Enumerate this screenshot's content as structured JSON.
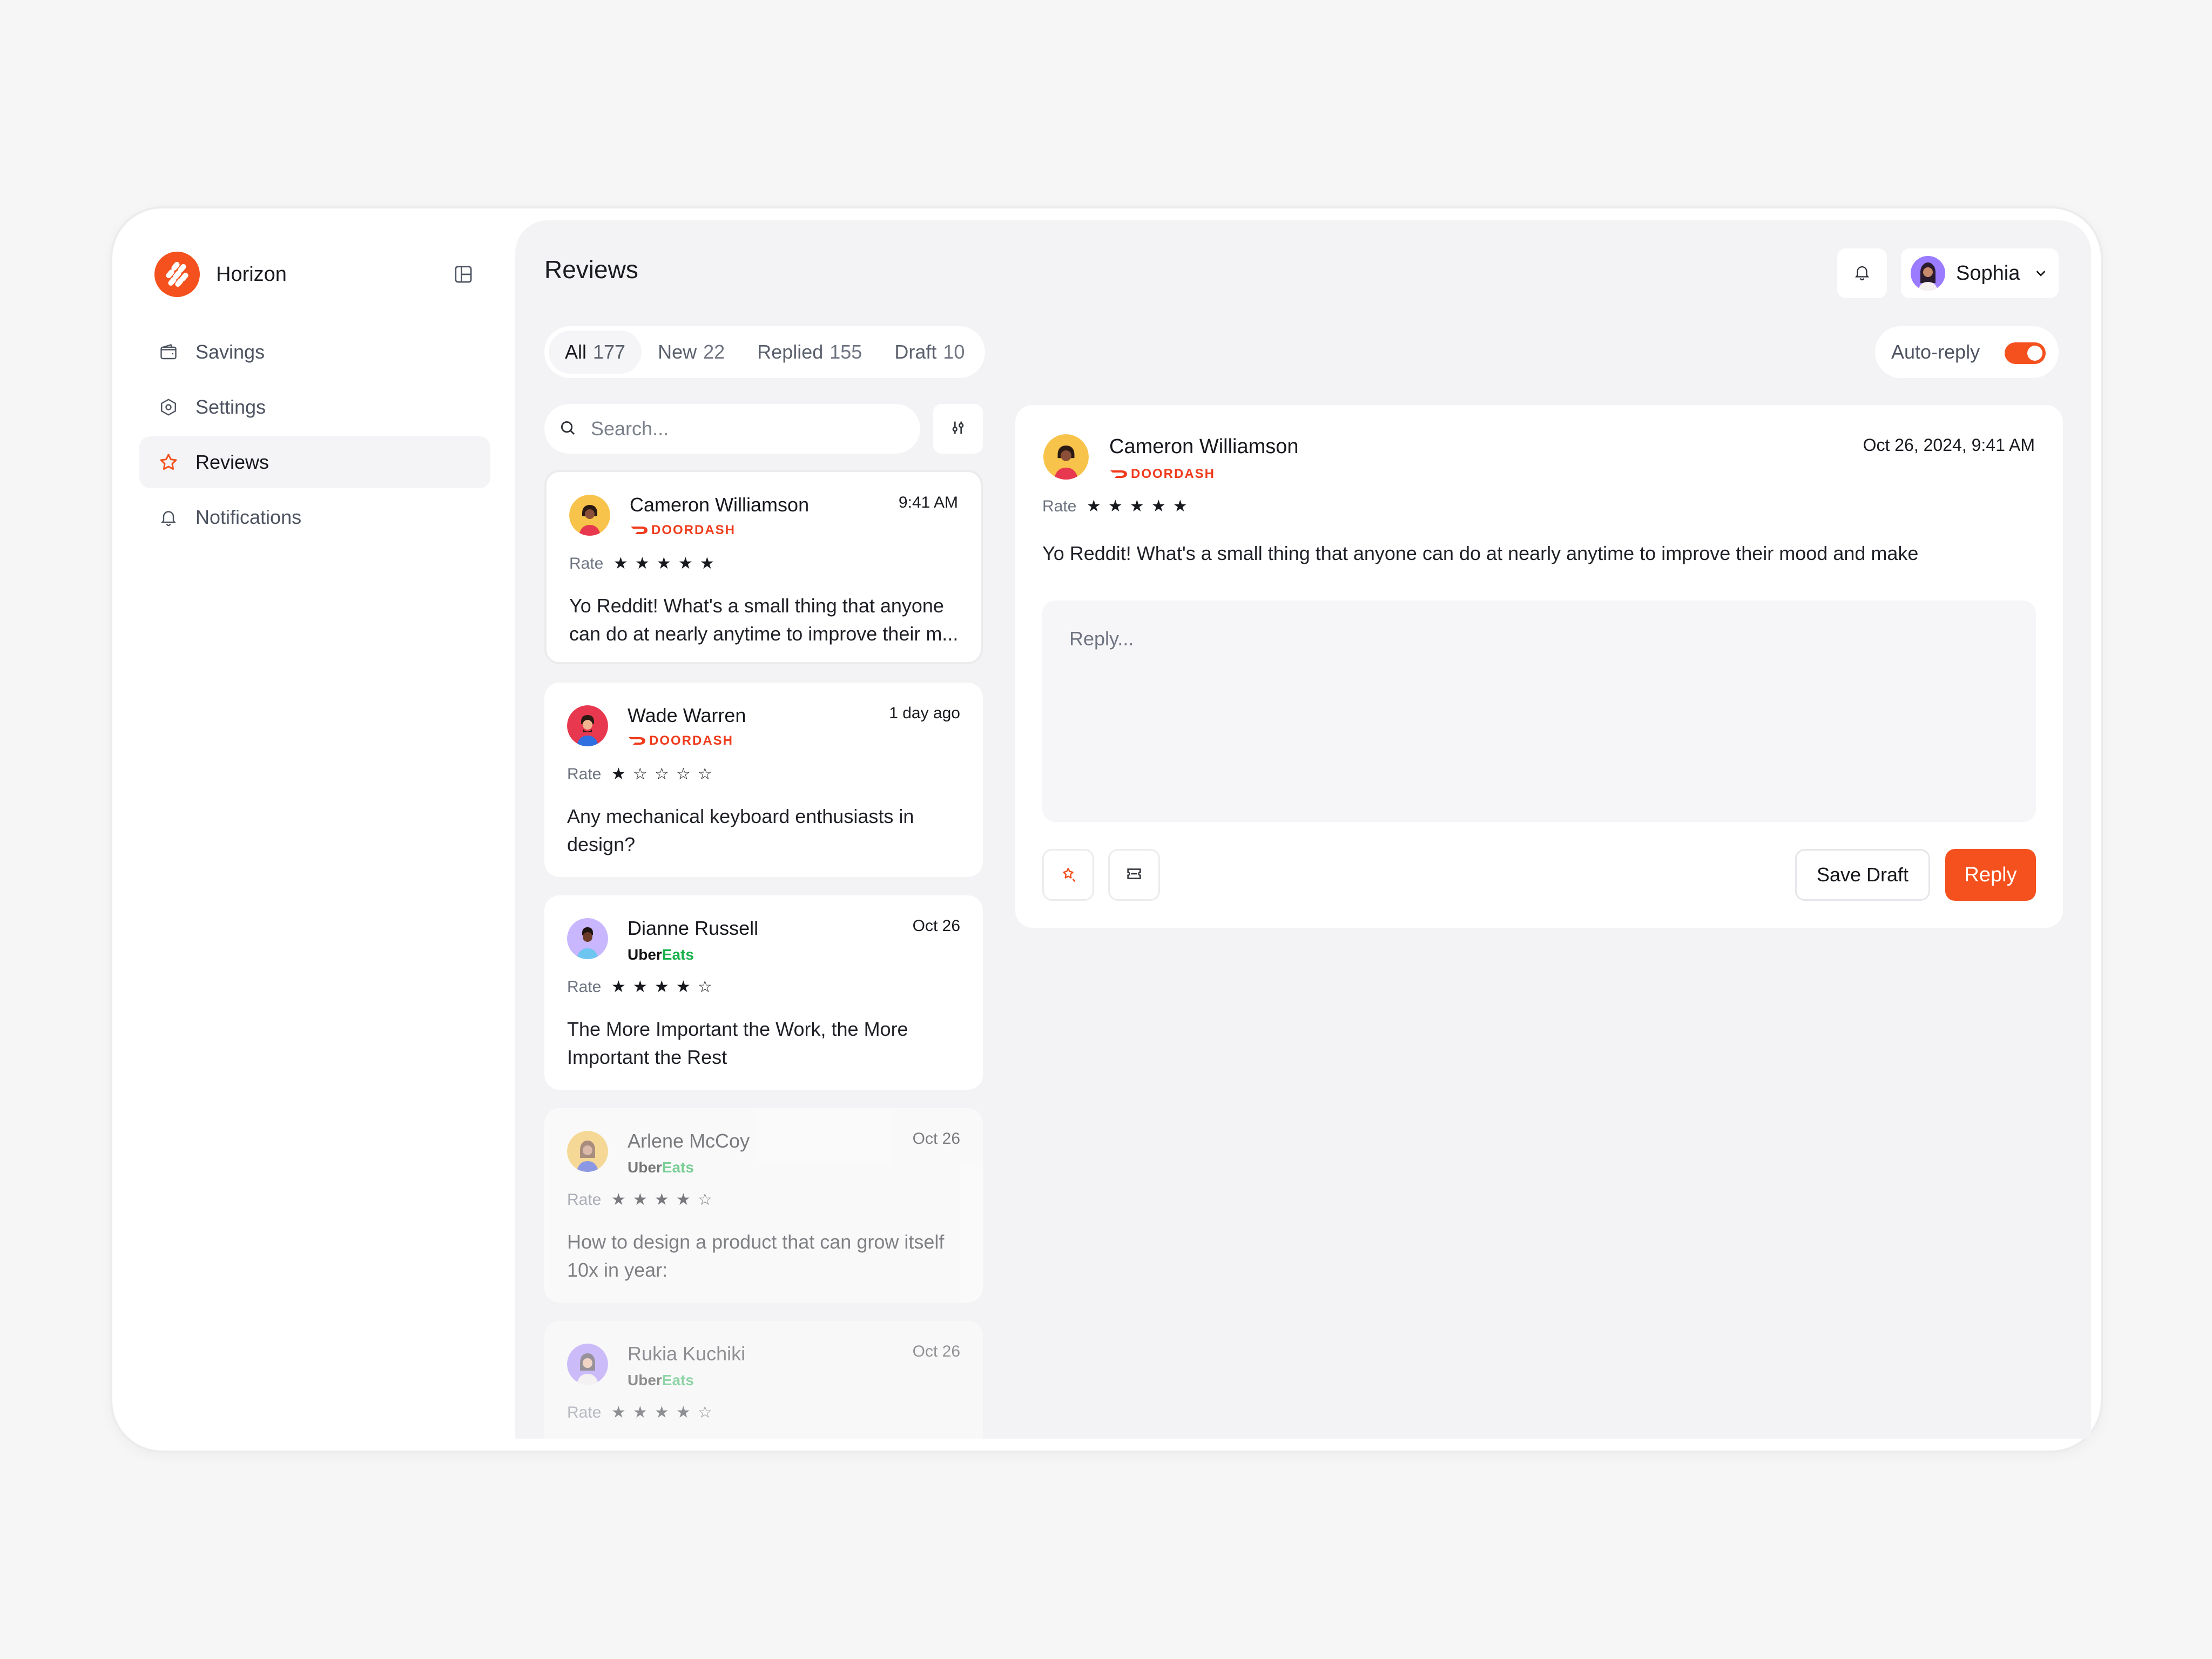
{
  "app": {
    "name": "Horizon"
  },
  "sidebar": {
    "items": [
      {
        "label": "Savings",
        "icon": "wallet-icon",
        "active": false
      },
      {
        "label": "Settings",
        "icon": "gear-icon",
        "active": false
      },
      {
        "label": "Reviews",
        "icon": "star-icon",
        "active": true
      },
      {
        "label": "Notifications",
        "icon": "bell-icon",
        "active": false
      }
    ]
  },
  "header": {
    "title": "Reviews",
    "user": {
      "name": "Sophia"
    }
  },
  "tabs": [
    {
      "label": "All",
      "count": "177",
      "active": true
    },
    {
      "label": "New",
      "count": "22",
      "active": false
    },
    {
      "label": "Replied",
      "count": "155",
      "active": false
    },
    {
      "label": "Draft",
      "count": "10",
      "active": false
    }
  ],
  "auto_reply": {
    "label": "Auto-reply",
    "enabled": true
  },
  "search": {
    "placeholder": "Search...",
    "value": ""
  },
  "reviews": [
    {
      "name": "Cameron Williamson",
      "source": "DOORDASH",
      "time": "9:41 AM",
      "rate_label": "Rate",
      "stars": 5,
      "text": "Yo Reddit! What's a small thing that anyone can do at nearly anytime to improve their m..."
    },
    {
      "name": "Wade Warren",
      "source": "DOORDASH",
      "time": "1 day ago",
      "rate_label": "Rate",
      "stars": 1,
      "text": "Any mechanical keyboard enthusiasts in design?"
    },
    {
      "name": "Dianne Russell",
      "source_uber": "Uber",
      "source_eats": "Eats",
      "time": "Oct 26",
      "rate_label": "Rate",
      "stars": 4,
      "text": "The More Important the Work, the More Important the Rest"
    },
    {
      "name": "Arlene McCoy",
      "source_uber": "Uber",
      "source_eats": "Eats",
      "time": "Oct 26",
      "rate_label": "Rate",
      "stars": 4,
      "text": "How to design a product that can grow itself 10x in year:"
    },
    {
      "name": "Rukia Kuchiki",
      "source_uber": "Uber",
      "source_eats": "Eats",
      "time": "Oct 26",
      "rate_label": "Rate",
      "stars": 4,
      "text": ""
    }
  ],
  "detail": {
    "name": "Cameron Williamson",
    "source": "DOORDASH",
    "time": "Oct 26, 2024, 9:41 AM",
    "rate_label": "Rate",
    "stars": 5,
    "text": "Yo Reddit! What's a small thing that anyone can do at nearly anytime to improve their mood and make",
    "reply_placeholder": "Reply...",
    "reply_value": "",
    "save_draft_label": "Save Draft",
    "reply_label": "Reply"
  },
  "colors": {
    "accent": "#f4511e",
    "doordash": "#ef3b1c",
    "uber_eats": "#19b04a"
  }
}
